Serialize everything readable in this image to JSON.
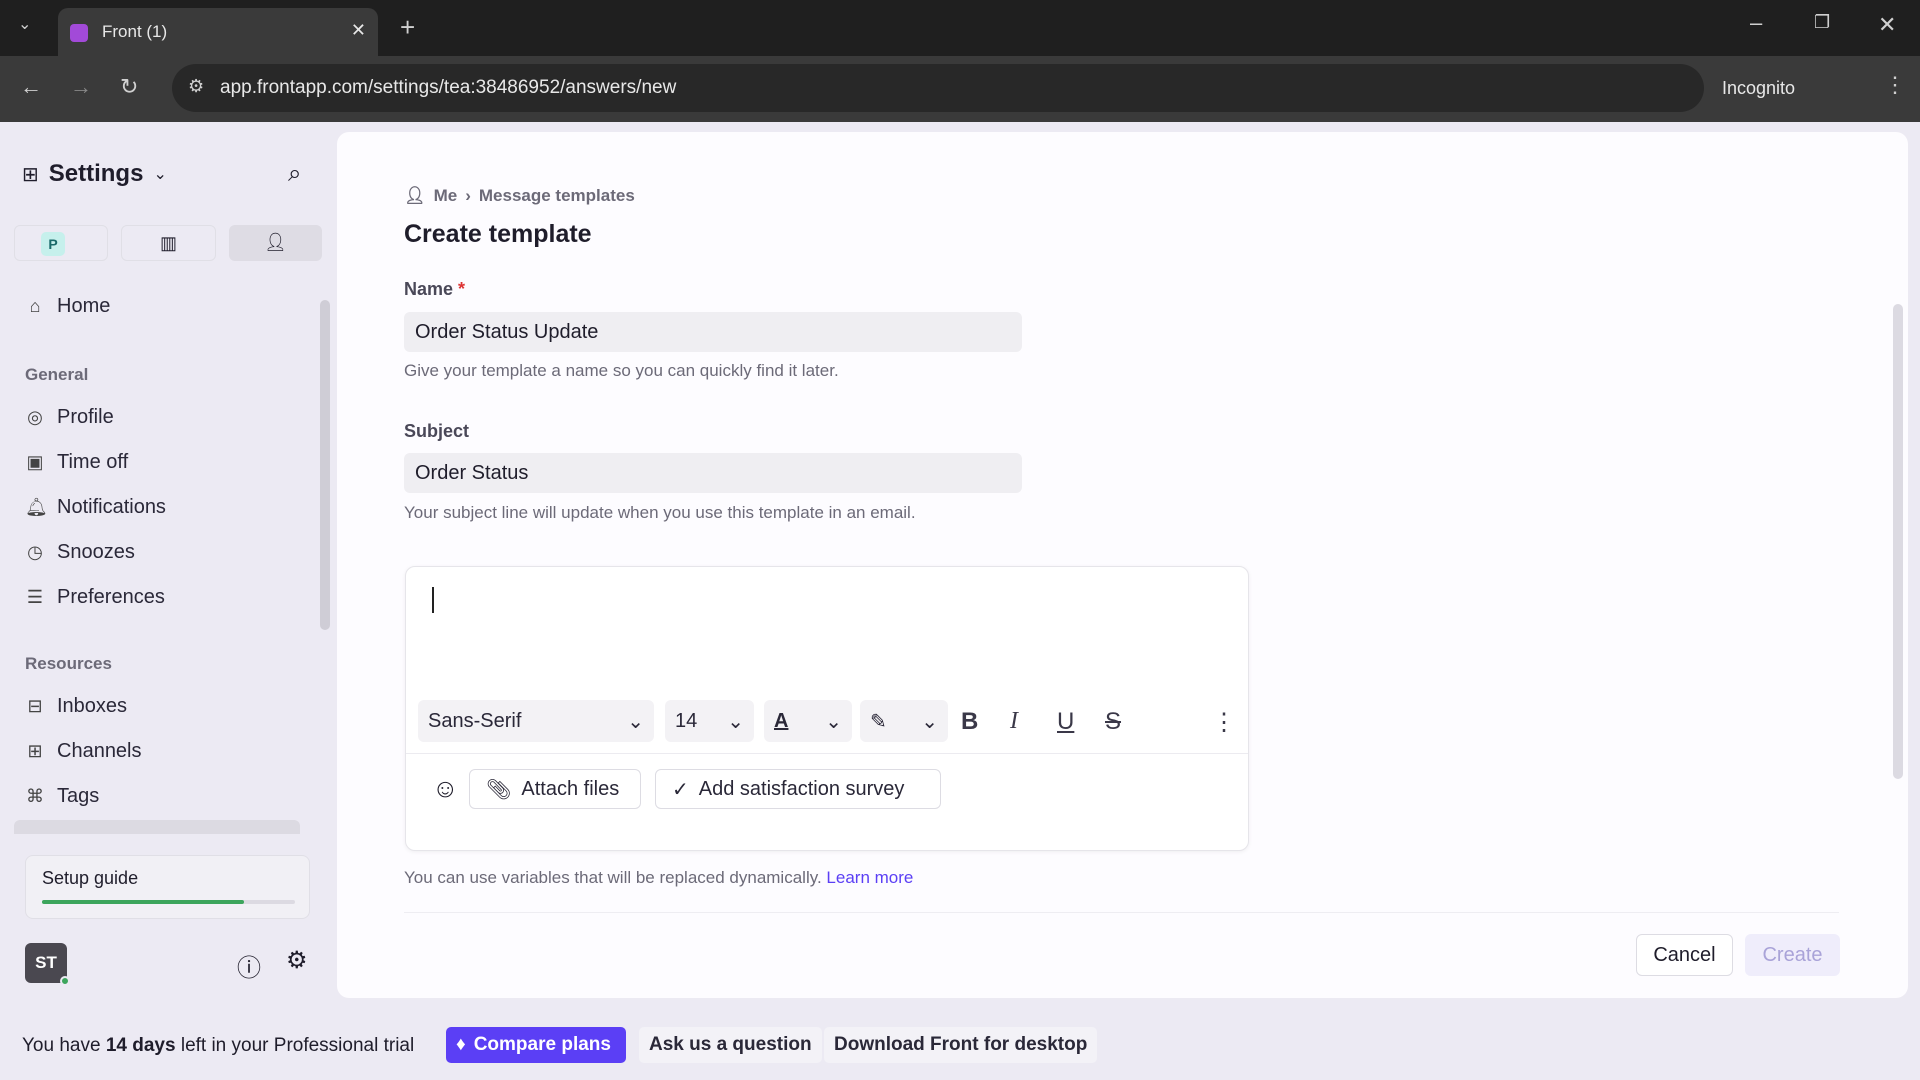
{
  "browser": {
    "tab_title": "Front (1)",
    "url": "app.frontapp.com/settings/tea:38486952/answers/new",
    "incognito_label": "Incognito"
  },
  "sidebar": {
    "title": "Settings",
    "workspace_badge": "P",
    "home": "Home",
    "sections": [
      {
        "label": "General",
        "items": [
          "Profile",
          "Time off",
          "Notifications",
          "Snoozes",
          "Preferences"
        ]
      },
      {
        "label": "Resources",
        "items": [
          "Inboxes",
          "Channels",
          "Tags"
        ]
      }
    ],
    "setup_guide": {
      "label": "Setup guide",
      "progress_percent": 80
    },
    "avatar_initials": "ST"
  },
  "main": {
    "breadcrumb": [
      "Me",
      "Message templates"
    ],
    "title": "Create template",
    "name": {
      "label": "Name",
      "required_mark": "*",
      "value": "Order Status Update",
      "hint": "Give your template a name so you can quickly find it later."
    },
    "subject": {
      "label": "Subject",
      "value": "Order Status",
      "hint": "Your subject line will update when you use this template in an email."
    },
    "editor": {
      "font": "Sans-Serif",
      "size": "14",
      "attach_label": "Attach files",
      "survey_label": "Add satisfaction survey"
    },
    "variables_hint": "You can use variables that will be replaced dynamically.",
    "learn_more": "Learn more",
    "cancel": "Cancel",
    "create": "Create"
  },
  "trial_bar": {
    "pre": "You have ",
    "days": "14 days",
    "post": " left in your Professional trial",
    "compare": "Compare plans",
    "ask": "Ask us a question",
    "download": "Download Front for desktop"
  },
  "colors": {
    "accent": "#5b3ff5",
    "progress": "#3ca55c"
  }
}
